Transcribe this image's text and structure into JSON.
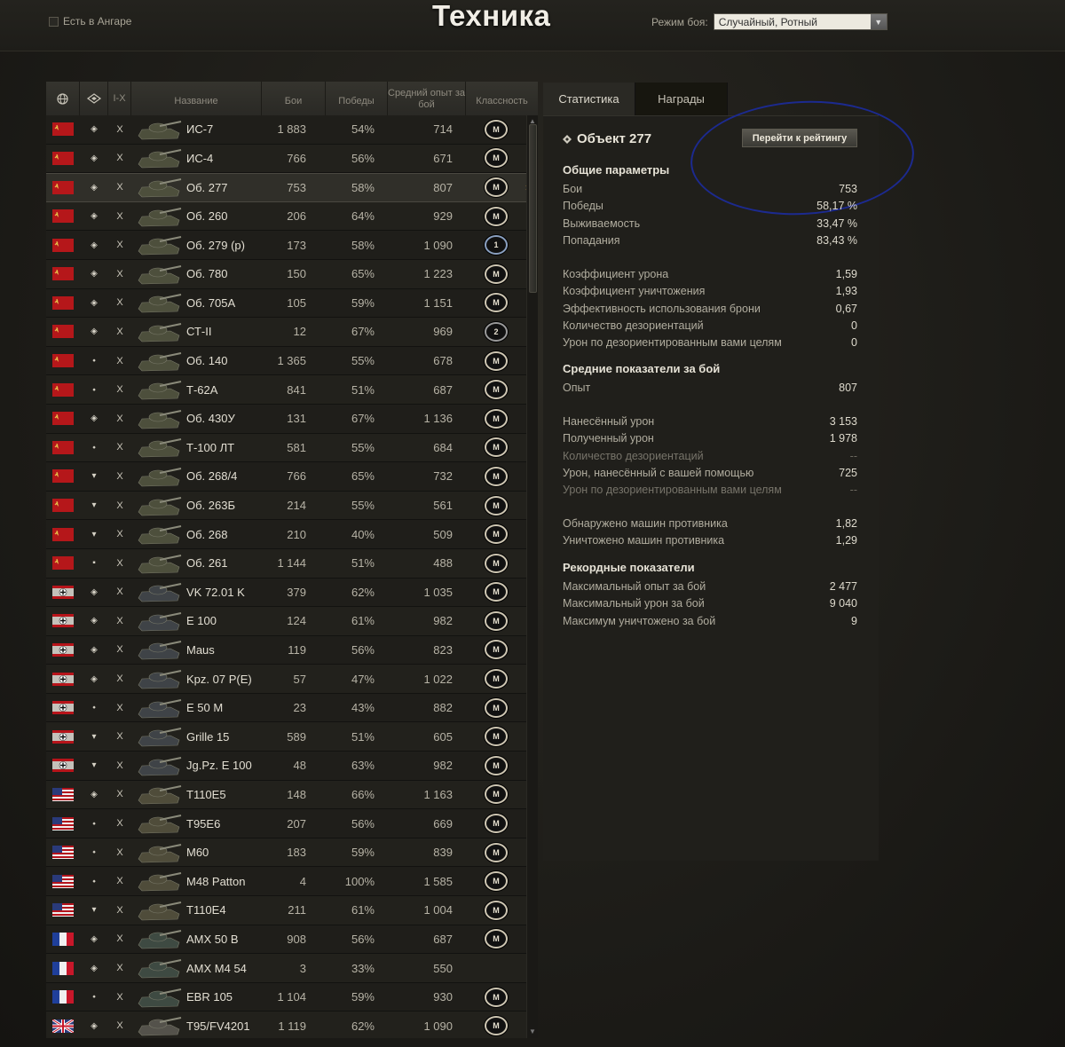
{
  "header": {
    "in_hangar_label": "Есть в Ангаре",
    "title": "Техника",
    "mode_label": "Режим боя:",
    "mode_value": "Случайный, Ротный"
  },
  "table": {
    "columns": {
      "tier_range": "I-X",
      "name": "Название",
      "battles": "Бои",
      "wins": "Победы",
      "avg_exp": "Средний опыт за бой",
      "mastery": "Классность"
    },
    "rows": [
      {
        "nation": "ussr",
        "name": "ИС-7",
        "battles": "1 883",
        "wins": "54%",
        "exp": "714",
        "badge": "M"
      },
      {
        "nation": "ussr",
        "name": "ИС-4",
        "battles": "766",
        "wins": "56%",
        "exp": "671",
        "badge": "M"
      },
      {
        "nation": "ussr",
        "name": "Об. 277",
        "battles": "753",
        "wins": "58%",
        "exp": "807",
        "badge": "M",
        "selected": true
      },
      {
        "nation": "ussr",
        "name": "Об. 260",
        "battles": "206",
        "wins": "64%",
        "exp": "929",
        "badge": "M"
      },
      {
        "nation": "ussr",
        "name": "Об. 279 (р)",
        "battles": "173",
        "wins": "58%",
        "exp": "1 090",
        "badge": "1"
      },
      {
        "nation": "ussr",
        "name": "Об. 780",
        "battles": "150",
        "wins": "65%",
        "exp": "1 223",
        "badge": "M"
      },
      {
        "nation": "ussr",
        "name": "Об. 705А",
        "battles": "105",
        "wins": "59%",
        "exp": "1 151",
        "badge": "M"
      },
      {
        "nation": "ussr",
        "name": "СТ-II",
        "battles": "12",
        "wins": "67%",
        "exp": "969",
        "badge": "2"
      },
      {
        "nation": "ussr",
        "name": "Об. 140",
        "battles": "1 365",
        "wins": "55%",
        "exp": "678",
        "badge": "M"
      },
      {
        "nation": "ussr",
        "name": "Т-62А",
        "battles": "841",
        "wins": "51%",
        "exp": "687",
        "badge": "M"
      },
      {
        "nation": "ussr",
        "name": "Об. 430У",
        "battles": "131",
        "wins": "67%",
        "exp": "1 136",
        "badge": "M"
      },
      {
        "nation": "ussr",
        "name": "Т-100 ЛТ",
        "battles": "581",
        "wins": "55%",
        "exp": "684",
        "badge": "M"
      },
      {
        "nation": "ussr",
        "name": "Об. 268/4",
        "battles": "766",
        "wins": "65%",
        "exp": "732",
        "badge": "M"
      },
      {
        "nation": "ussr",
        "name": "Об. 263Б",
        "battles": "214",
        "wins": "55%",
        "exp": "561",
        "badge": "M"
      },
      {
        "nation": "ussr",
        "name": "Об. 268",
        "battles": "210",
        "wins": "40%",
        "exp": "509",
        "badge": "M"
      },
      {
        "nation": "ussr",
        "name": "Об. 261",
        "battles": "1 144",
        "wins": "51%",
        "exp": "488",
        "badge": "M"
      },
      {
        "nation": "germany",
        "name": "VK 72.01 K",
        "battles": "379",
        "wins": "62%",
        "exp": "1 035",
        "badge": "M"
      },
      {
        "nation": "germany",
        "name": "E 100",
        "battles": "124",
        "wins": "61%",
        "exp": "982",
        "badge": "M"
      },
      {
        "nation": "germany",
        "name": "Maus",
        "battles": "119",
        "wins": "56%",
        "exp": "823",
        "badge": "M"
      },
      {
        "nation": "germany",
        "name": "Kpz. 07 P(E)",
        "battles": "57",
        "wins": "47%",
        "exp": "1 022",
        "badge": "M"
      },
      {
        "nation": "germany",
        "name": "E 50 M",
        "battles": "23",
        "wins": "43%",
        "exp": "882",
        "badge": "M"
      },
      {
        "nation": "germany",
        "name": "Grille 15",
        "battles": "589",
        "wins": "51%",
        "exp": "605",
        "badge": "M"
      },
      {
        "nation": "germany",
        "name": "Jg.Pz. E 100",
        "battles": "48",
        "wins": "63%",
        "exp": "982",
        "badge": "M"
      },
      {
        "nation": "usa",
        "name": "T110E5",
        "battles": "148",
        "wins": "66%",
        "exp": "1 163",
        "badge": "M"
      },
      {
        "nation": "usa",
        "name": "T95E6",
        "battles": "207",
        "wins": "56%",
        "exp": "669",
        "badge": "M"
      },
      {
        "nation": "usa",
        "name": "M60",
        "battles": "183",
        "wins": "59%",
        "exp": "839",
        "badge": "M"
      },
      {
        "nation": "usa",
        "name": "M48 Patton",
        "battles": "4",
        "wins": "100%",
        "exp": "1 585",
        "badge": "M"
      },
      {
        "nation": "usa",
        "name": "T110E4",
        "battles": "211",
        "wins": "61%",
        "exp": "1 004",
        "badge": "M"
      },
      {
        "nation": "france",
        "name": "AMX 50 B",
        "battles": "908",
        "wins": "56%",
        "exp": "687",
        "badge": "M"
      },
      {
        "nation": "france",
        "name": "AMX M4 54",
        "battles": "3",
        "wins": "33%",
        "exp": "550",
        "badge": ""
      },
      {
        "nation": "france",
        "name": "EBR 105",
        "battles": "1 104",
        "wins": "59%",
        "exp": "930",
        "badge": "M"
      },
      {
        "nation": "uk",
        "name": "T95/FV4201",
        "battles": "1 119",
        "wins": "62%",
        "exp": "1 090",
        "badge": "M"
      }
    ]
  },
  "panel": {
    "tabs": [
      "Статистика",
      "Награды"
    ],
    "vehicle": "Объект 277",
    "rating_button": "Перейти к рейтингу",
    "sections": {
      "general": "Общие параметры",
      "average": "Средние показатели за бой",
      "records": "Рекордные показатели"
    },
    "general": [
      {
        "label": "Бои",
        "value": "753"
      },
      {
        "label": "Победы",
        "value": "58,17 %"
      },
      {
        "label": "Выживаемость",
        "value": "33,47 %"
      },
      {
        "label": "Попадания",
        "value": "83,43 %"
      }
    ],
    "coeffs": [
      {
        "label": "Коэффициент урона",
        "value": "1,59"
      },
      {
        "label": "Коэффициент уничтожения",
        "value": "1,93"
      },
      {
        "label": "Эффективность использования брони",
        "value": "0,67"
      },
      {
        "label": "Количество дезориентаций",
        "value": "0"
      },
      {
        "label": "Урон по дезориентированным вами целям",
        "value": "0"
      }
    ],
    "avg_exp": {
      "label": "Опыт",
      "value": "807"
    },
    "damage": [
      {
        "label": "Нанесённый урон",
        "value": "3 153"
      },
      {
        "label": "Полученный урон",
        "value": "1 978"
      },
      {
        "label": "Количество дезориентаций",
        "value": "--"
      },
      {
        "label": "Урон, нанесённый с вашей помощью",
        "value": "725"
      },
      {
        "label": "Урон по дезориентированным вами целям",
        "value": "--"
      }
    ],
    "spotting": [
      {
        "label": "Обнаружено машин противника",
        "value": "1,82"
      },
      {
        "label": "Уничтожено машин противника",
        "value": "1,29"
      }
    ],
    "records": [
      {
        "label": "Максимальный опыт за бой",
        "value": "2 477"
      },
      {
        "label": "Максимальный урон за бой",
        "value": "9 040"
      },
      {
        "label": "Максимум уничтожено за бой",
        "value": "9"
      }
    ]
  }
}
